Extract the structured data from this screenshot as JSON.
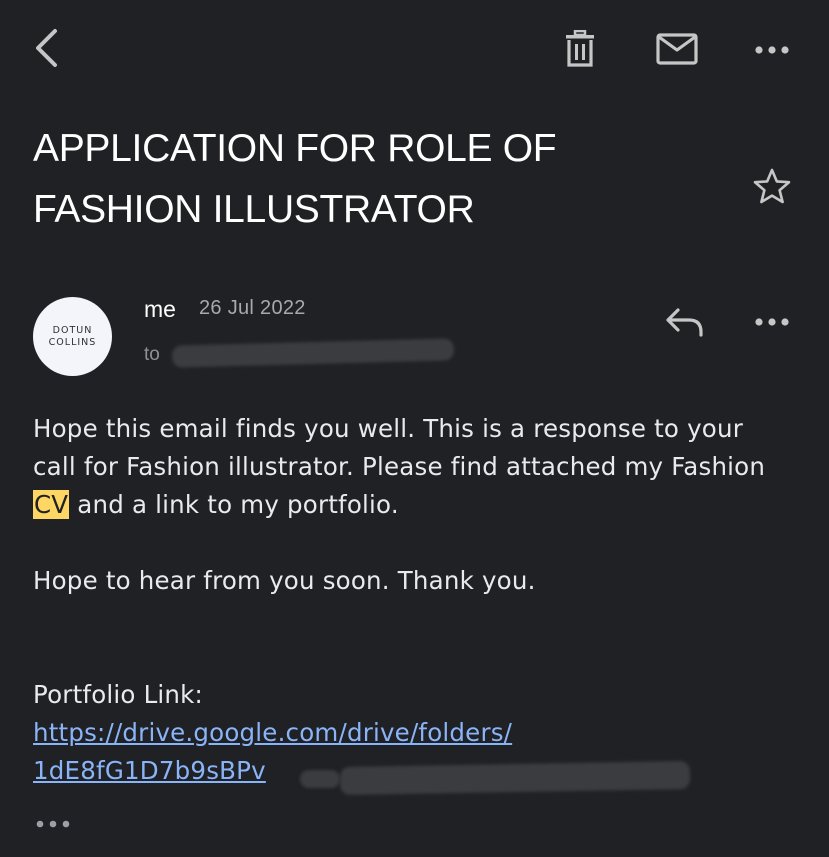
{
  "toolbar": {
    "back_icon": "chevron-left-icon",
    "delete_icon": "trash-icon",
    "mark_unread_icon": "mail-icon",
    "more_icon": "more-horizontal-icon"
  },
  "email": {
    "subject_line1": "APPLICATION FOR ROLE OF",
    "subject_line2": "FASHION ILLUSTRATOR",
    "starred": false,
    "avatar": {
      "line1": "DOTUN",
      "line2": "COLLINS"
    },
    "sender": "me",
    "date": "26 Jul 2022",
    "to_prefix": "to",
    "body": {
      "p1_before": "Hope this email finds you well. This is a response to your call for Fashion illustrator. Please find attached my Fashion ",
      "p1_highlight": "CV",
      "p1_after": " and a link to my portfolio.",
      "p2": "Hope to hear from you soon. Thank you.",
      "portfolio_label": "Portfolio Link:",
      "link_line1": "https://drive.google.com/drive/folders/",
      "link_line2": "1dE8fG1D7b9sBPv"
    }
  },
  "colors": {
    "background": "#202124",
    "text": "#e8eaed",
    "link": "#8ab4f8",
    "highlight": "#fdd663"
  }
}
